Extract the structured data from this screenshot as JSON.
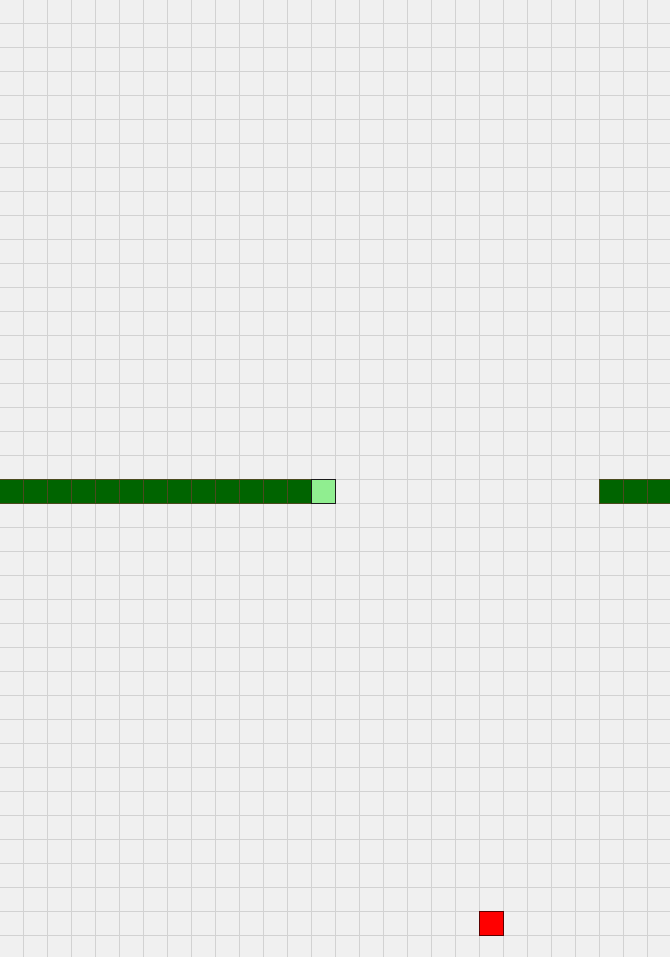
{
  "game": {
    "name": "snake",
    "grid": {
      "columns": 28,
      "rows": 40
    },
    "colors": {
      "background": "#f0f0f0",
      "grid_line": "#d2d2d2",
      "snake_body": "#006400",
      "snake_head": "#90ee90",
      "food": "#ff0000"
    },
    "snake": {
      "head": {
        "col": 13,
        "row": 20
      },
      "body": [
        {
          "col": 12,
          "row": 20
        },
        {
          "col": 11,
          "row": 20
        },
        {
          "col": 10,
          "row": 20
        },
        {
          "col": 9,
          "row": 20
        },
        {
          "col": 8,
          "row": 20
        },
        {
          "col": 7,
          "row": 20
        },
        {
          "col": 6,
          "row": 20
        },
        {
          "col": 5,
          "row": 20
        },
        {
          "col": 4,
          "row": 20
        },
        {
          "col": 3,
          "row": 20
        },
        {
          "col": 2,
          "row": 20
        },
        {
          "col": 1,
          "row": 20
        },
        {
          "col": 0,
          "row": 20
        },
        {
          "col": 27,
          "row": 20
        },
        {
          "col": 26,
          "row": 20
        },
        {
          "col": 25,
          "row": 20
        }
      ]
    },
    "food": {
      "col": 20,
      "row": 38
    }
  }
}
